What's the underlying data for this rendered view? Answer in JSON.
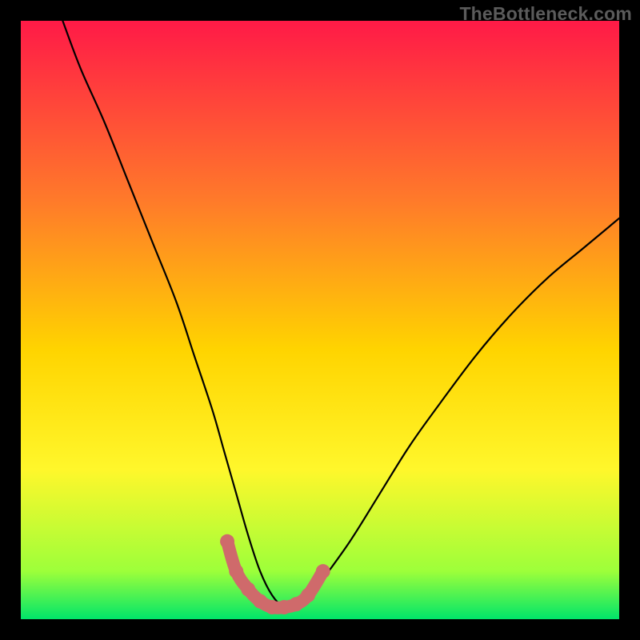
{
  "watermark": "TheBottleneck.com",
  "colors": {
    "frame": "#000000",
    "curve": "#000000",
    "marker_stroke": "#cf6a6b",
    "marker_fill": "#cf6a6b",
    "gradient_top": "#ff1a47",
    "gradient_q1": "#ff7a2a",
    "gradient_mid": "#ffd400",
    "gradient_q3": "#fff72b",
    "gradient_low": "#9dff3a",
    "gradient_bottom": "#00e56a"
  },
  "chart_data": {
    "type": "line",
    "title": "",
    "xlabel": "",
    "ylabel": "",
    "xlim": [
      0,
      100
    ],
    "ylim": [
      0,
      100
    ],
    "series": [
      {
        "name": "bottleneck-curve",
        "x": [
          7,
          10,
          14,
          18,
          22,
          26,
          29,
          32,
          34,
          36,
          38,
          40,
          42,
          44,
          46,
          48,
          50,
          55,
          60,
          65,
          70,
          76,
          82,
          88,
          94,
          100
        ],
        "values": [
          100,
          92,
          83,
          73,
          63,
          53,
          44,
          35,
          28,
          21,
          14,
          8,
          4,
          2,
          2,
          3,
          6,
          13,
          21,
          29,
          36,
          44,
          51,
          57,
          62,
          67
        ]
      }
    ],
    "highlight_segment": {
      "name": "optimal-range",
      "x": [
        34.5,
        36,
        38,
        40,
        42,
        44,
        46,
        48,
        50.5
      ],
      "values": [
        13,
        8,
        5,
        3,
        2,
        2,
        2.5,
        4,
        8
      ]
    },
    "gradient_stops_pct": [
      0,
      30,
      55,
      75,
      92,
      100
    ]
  }
}
